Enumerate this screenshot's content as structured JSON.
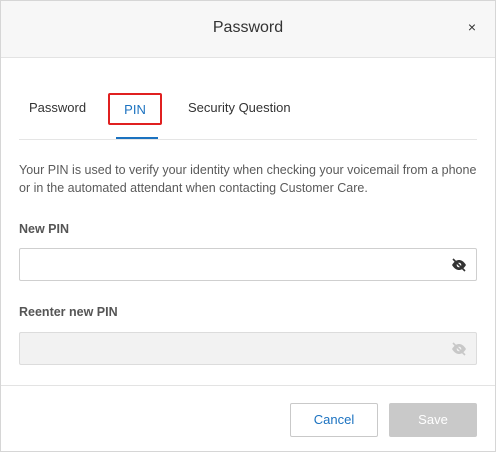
{
  "dialog": {
    "title": "Password",
    "close_glyph": "×"
  },
  "tabs": [
    {
      "label": "Password",
      "active": false
    },
    {
      "label": "PIN",
      "active": true
    },
    {
      "label": "Security Question",
      "active": false
    }
  ],
  "description": "Your PIN is used to verify your identity when checking your voicemail from a phone or in the automated attendant when contacting Customer Care.",
  "fields": {
    "new_pin": {
      "label": "New PIN",
      "value": "",
      "icon": "eye-slash-icon",
      "disabled": false
    },
    "reenter_pin": {
      "label": "Reenter new PIN",
      "value": "",
      "icon": "eye-slash-icon",
      "disabled": true
    }
  },
  "buttons": {
    "cancel_label": "Cancel",
    "save_label": "Save"
  },
  "colors": {
    "accent": "#1b72c0",
    "highlight_box": "#e02020",
    "disabled_button": "#c9c9c9"
  }
}
